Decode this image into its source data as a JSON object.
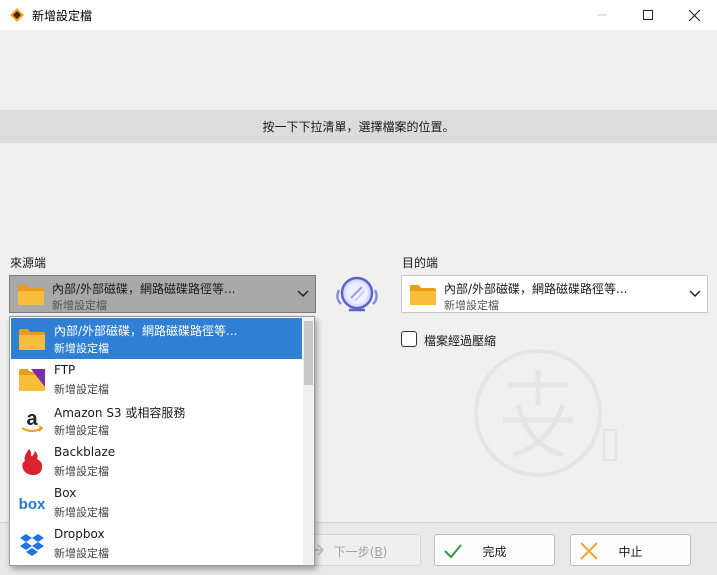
{
  "window": {
    "title": "新增設定檔"
  },
  "info": {
    "message": "按一下下拉清單，選擇檔案的位置。"
  },
  "source": {
    "label": "來源端",
    "selected_name": "內部/外部磁碟，網路磁碟路徑等...",
    "selected_sub": "新增設定檔"
  },
  "destination": {
    "label": "目的端",
    "selected_name": "內部/外部磁碟，網路磁碟路徑等...",
    "selected_sub": "新增設定檔",
    "compress_label": "檔案經過壓縮",
    "compress_checked": false
  },
  "dropdown": {
    "items": [
      {
        "name": "內部/外部磁碟，網路磁碟路徑等...",
        "sub": "新增設定檔",
        "icon": "folder-icon",
        "selected": true
      },
      {
        "name": "FTP",
        "sub": "新增設定檔",
        "icon": "ftp-folder-icon",
        "selected": false
      },
      {
        "name": "Amazon S3 或相容服務",
        "sub": "新增設定檔",
        "icon": "amazon-icon",
        "selected": false
      },
      {
        "name": "Backblaze",
        "sub": "新增設定檔",
        "icon": "backblaze-icon",
        "selected": false
      },
      {
        "name": "Box",
        "sub": "新增設定檔",
        "icon": "box-icon",
        "selected": false
      },
      {
        "name": "Dropbox",
        "sub": "新增設定檔",
        "icon": "dropbox-icon",
        "selected": false
      }
    ]
  },
  "buttons": {
    "next": "下一步(",
    "next_key": "B",
    "next_close": ")",
    "finish": "完成",
    "abort": "中止"
  },
  "colors": {
    "selection": "#2f7fd4",
    "folder": "#f6b32b",
    "finish_check": "#2e9b3a",
    "abort_x": "#f2a33a"
  }
}
